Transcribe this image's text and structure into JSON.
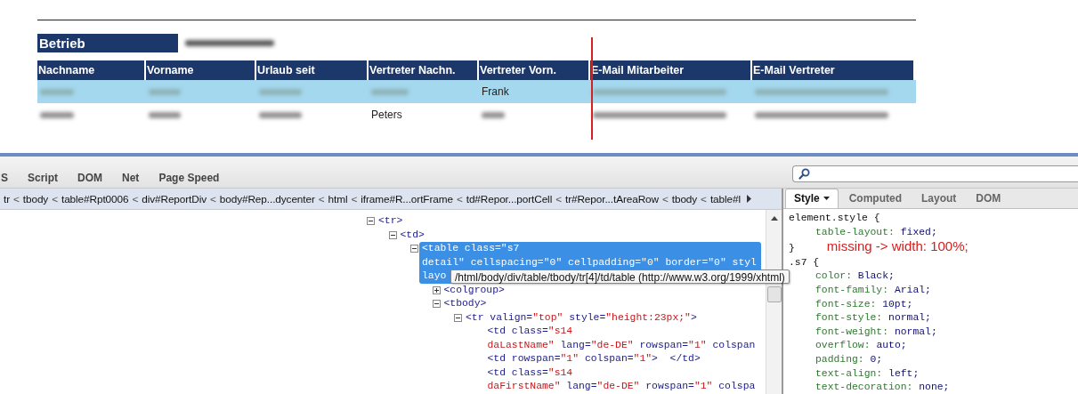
{
  "page": {
    "group": {
      "label": "Betrieb",
      "value_blurred": true
    },
    "table": {
      "columns": [
        "Nachname",
        "Vorname",
        "Urlaub seit",
        "Vertreter Nachn.",
        "Vertreter Vorn.",
        "E-Mail Mitarbeiter",
        "E-Mail Vertreter"
      ],
      "rows": [
        {
          "highlighted": true,
          "cells": [
            {
              "blurred": true
            },
            {
              "blurred": true
            },
            {
              "blurred": true
            },
            {
              "blurred": true
            },
            {
              "text": "Frank",
              "blurred": false
            },
            {
              "blurred": true
            },
            {
              "blurred": true
            }
          ]
        },
        {
          "highlighted": false,
          "cells": [
            {
              "blurred": true
            },
            {
              "blurred": true
            },
            {
              "blurred": true
            },
            {
              "text": "Peters",
              "blurred": false
            },
            {
              "blurred": true
            },
            {
              "blurred": true
            },
            {
              "blurred": true
            }
          ]
        }
      ]
    }
  },
  "firebug": {
    "tabs": [
      {
        "label": "S"
      },
      {
        "label": "Script"
      },
      {
        "label": "DOM"
      },
      {
        "label": "Net"
      },
      {
        "label": "Page Speed"
      }
    ],
    "breadcrumbs": [
      {
        "label": "tr",
        "kind": "node"
      },
      {
        "label": "<",
        "kind": "sep"
      },
      {
        "label": "tbody",
        "kind": "node"
      },
      {
        "label": "<",
        "kind": "sep"
      },
      {
        "label": "table#Rpt0006",
        "kind": "node"
      },
      {
        "label": "<",
        "kind": "sep"
      },
      {
        "label": "div#ReportDiv",
        "kind": "node"
      },
      {
        "label": "<",
        "kind": "sep"
      },
      {
        "label": "body#Rep...dycenter",
        "kind": "node"
      },
      {
        "label": "<",
        "kind": "sep"
      },
      {
        "label": "html",
        "kind": "node"
      },
      {
        "label": "<",
        "kind": "sep"
      },
      {
        "label": "iframe#R...ortFrame",
        "kind": "node"
      },
      {
        "label": "<",
        "kind": "sep"
      },
      {
        "label": "td#Repor...portCell",
        "kind": "node"
      },
      {
        "label": "<",
        "kind": "sep"
      },
      {
        "label": "tr#Repor...tAreaRow",
        "kind": "node"
      },
      {
        "label": "<",
        "kind": "sep"
      },
      {
        "label": "tbody",
        "kind": "node"
      },
      {
        "label": "<",
        "kind": "sep"
      },
      {
        "label": "table#l",
        "kind": "node"
      }
    ],
    "tree": [
      {
        "expanded": true,
        "selected": false,
        "lines": [
          [
            {
              "text": "<tr>",
              "kind": "tag"
            }
          ]
        ],
        "children": [
          {
            "expanded": true,
            "selected": false,
            "lines": [
              [
                {
                  "text": "<td>",
                  "kind": "tag"
                }
              ]
            ],
            "children": [
              {
                "expanded": true,
                "selected": true,
                "lines": [
                  [
                    {
                      "text": "<table class=\"s7",
                      "kind": "tag"
                    }
                  ],
                  [
                    {
                      "text": "detail\" cellspacing=\"0\" cellpadding=\"0\" border=\"0\" styl",
                      "kind": "tag"
                    }
                  ],
                  [
                    {
                      "text": "layo",
                      "kind": "tag"
                    }
                  ]
                ],
                "children": [
                  {
                    "expanded": false,
                    "selected": false,
                    "lines": [
                      [
                        {
                          "text": "<colgroup>",
                          "kind": "tag"
                        }
                      ]
                    ]
                  },
                  {
                    "expanded": true,
                    "selected": false,
                    "lines": [
                      [
                        {
                          "text": "<tbody>",
                          "kind": "tag"
                        }
                      ]
                    ],
                    "children": [
                      {
                        "expanded": true,
                        "selected": false,
                        "lines": [
                          [
                            {
                              "text": "<tr valign=",
                              "kind": "tag"
                            },
                            {
                              "text": "\"top\"",
                              "kind": "value"
                            },
                            {
                              "text": " style=",
                              "kind": "tag"
                            },
                            {
                              "text": "\"height:23px;\"",
                              "kind": "value"
                            },
                            {
                              "text": ">",
                              "kind": "tag"
                            }
                          ]
                        ],
                        "children": [
                          {
                            "selected": false,
                            "lines": [
                              [
                                {
                                  "text": "<td class=",
                                  "kind": "tag"
                                },
                                {
                                  "text": "\"s14",
                                  "kind": "value"
                                }
                              ],
                              [
                                {
                                  "text": "daLastName\"",
                                  "kind": "value"
                                },
                                {
                                  "text": " lang=",
                                  "kind": "tag"
                                },
                                {
                                  "text": "\"de-DE\"",
                                  "kind": "value"
                                },
                                {
                                  "text": " rowspan=",
                                  "kind": "tag"
                                },
                                {
                                  "text": "\"1\"",
                                  "kind": "value"
                                },
                                {
                                  "text": " colspan",
                                  "kind": "tag"
                                }
                              ]
                            ]
                          },
                          {
                            "selected": false,
                            "lines": [
                              [
                                {
                                  "text": "<td rowspan=",
                                  "kind": "tag"
                                },
                                {
                                  "text": "\"1\"",
                                  "kind": "value"
                                },
                                {
                                  "text": " colspan=",
                                  "kind": "tag"
                                },
                                {
                                  "text": "\"1\"",
                                  "kind": "value"
                                },
                                {
                                  "text": ">  </td>",
                                  "kind": "tag"
                                }
                              ]
                            ]
                          },
                          {
                            "selected": false,
                            "lines": [
                              [
                                {
                                  "text": "<td class=",
                                  "kind": "tag"
                                },
                                {
                                  "text": "\"s14",
                                  "kind": "value"
                                }
                              ],
                              [
                                {
                                  "text": "daFirstName\"",
                                  "kind": "value"
                                },
                                {
                                  "text": " lang=",
                                  "kind": "tag"
                                },
                                {
                                  "text": "\"de-DE\"",
                                  "kind": "value"
                                },
                                {
                                  "text": " rowspan=",
                                  "kind": "tag"
                                },
                                {
                                  "text": "\"1\"",
                                  "kind": "value"
                                },
                                {
                                  "text": " colspa",
                                  "kind": "tag"
                                }
                              ]
                            ]
                          }
                        ]
                      }
                    ]
                  }
                ]
              }
            ]
          }
        ]
      }
    ],
    "tooltip": "/html/body/div/table/tbody/tr[4]/td/table (http://www.w3.org/1999/xhtml)",
    "side_tabs": [
      {
        "label": "Style",
        "selected": true,
        "dropdown": true
      },
      {
        "label": "Computed",
        "selected": false,
        "dropdown": false
      },
      {
        "label": "Layout",
        "selected": false,
        "dropdown": false
      },
      {
        "label": "DOM",
        "selected": false,
        "dropdown": false
      }
    ],
    "rules": [
      {
        "selector": "element.style {",
        "props": [
          {
            "name": "table-layout:",
            "value": "fixed;"
          }
        ],
        "close": "}",
        "annotation": "missing -> width: 100%;"
      },
      {
        "selector": ".s7 {",
        "props": [
          {
            "name": "color:",
            "value": "Black;"
          },
          {
            "name": "font-family:",
            "value": "Arial;"
          },
          {
            "name": "font-size:",
            "value": "10pt;"
          },
          {
            "name": "font-style:",
            "value": "normal;"
          },
          {
            "name": "font-weight:",
            "value": "normal;"
          },
          {
            "name": "overflow:",
            "value": "auto;"
          },
          {
            "name": "padding:",
            "value": "0;"
          },
          {
            "name": "text-align:",
            "value": "left;"
          },
          {
            "name": "text-decoration:",
            "value": "none;"
          }
        ]
      }
    ]
  }
}
